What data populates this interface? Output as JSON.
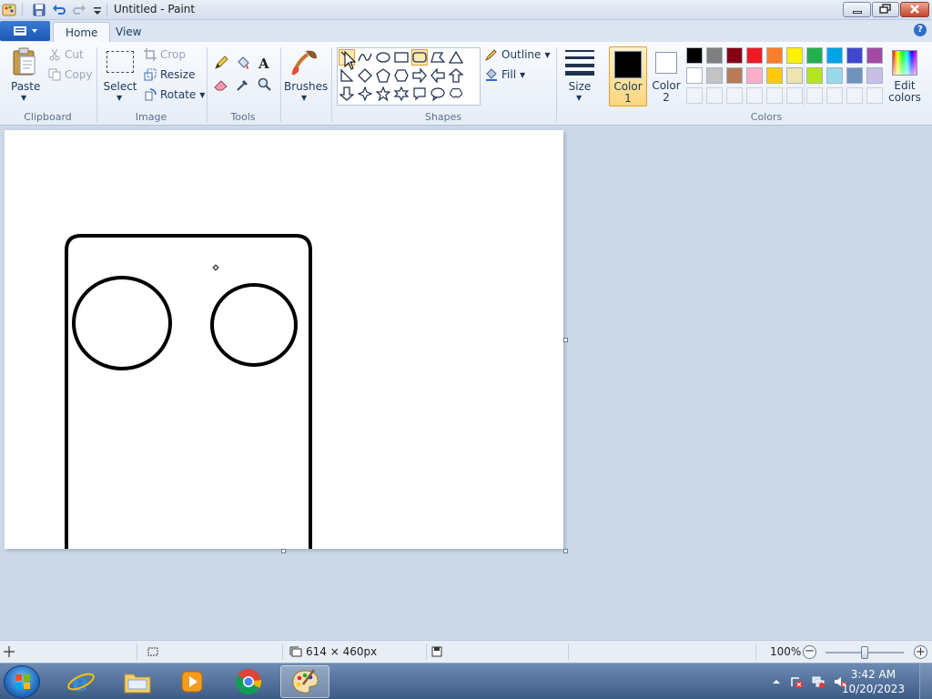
{
  "window": {
    "title": "Untitled - Paint"
  },
  "tabs": [
    {
      "label": "Home"
    },
    {
      "label": "View"
    }
  ],
  "ribbon": {
    "clipboard": {
      "group": "Clipboard",
      "paste": "Paste",
      "cut": "Cut",
      "copy": "Copy"
    },
    "image": {
      "group": "Image",
      "select": "Select",
      "crop": "Crop",
      "resize": "Resize",
      "rotate": "Rotate"
    },
    "tools": {
      "group": "Tools"
    },
    "brushes": {
      "label": "Brushes"
    },
    "shapes": {
      "group": "Shapes",
      "outline": "Outline",
      "fill": "Fill"
    },
    "size": {
      "label": "Size"
    },
    "colors": {
      "group": "Colors",
      "color1_line1": "Color",
      "color1_line2": "1",
      "color2_line1": "Color",
      "color2_line2": "2",
      "edit_line1": "Edit",
      "edit_line2": "colors",
      "color1_value": "#000000",
      "color2_value": "#ffffff",
      "palette_row1": [
        "#000000",
        "#7f7f7f",
        "#880015",
        "#ed1c24",
        "#ff7f27",
        "#fff200",
        "#22b14c",
        "#00a2e8",
        "#3f48cc",
        "#a349a4"
      ],
      "palette_row2": [
        "#ffffff",
        "#c3c3c3",
        "#b97a57",
        "#ffaec9",
        "#ffc90e",
        "#efe4b0",
        "#b5e61d",
        "#99d9ea",
        "#7092be",
        "#c8bfe7"
      ]
    }
  },
  "status": {
    "canvas_size": "614 × 460px",
    "zoom": "100%",
    "zoom_level": 0.5
  },
  "taskbar": {
    "time": "3:42 AM",
    "date": "10/20/2023"
  }
}
